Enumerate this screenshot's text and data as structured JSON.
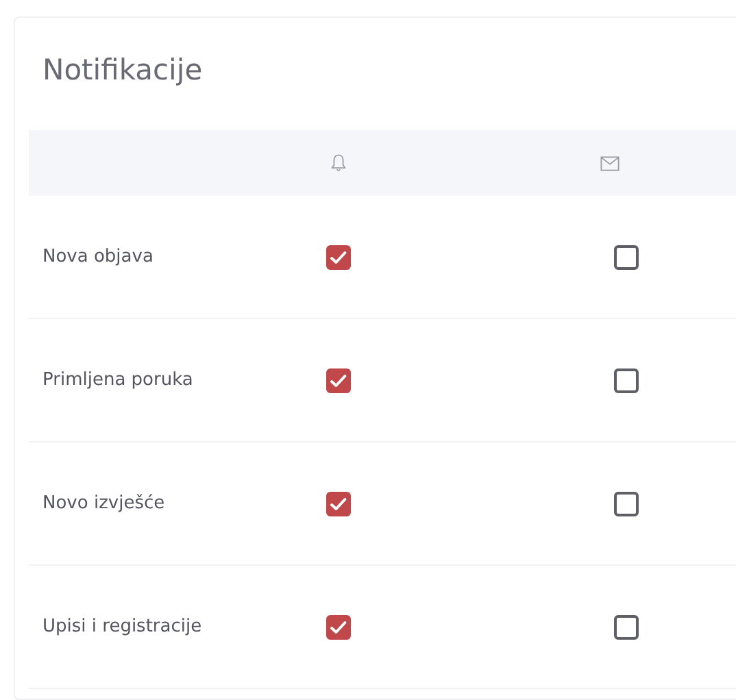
{
  "title": "Notifikacije",
  "rows": [
    {
      "label": "Nova objava",
      "push": {
        "checked": true
      },
      "email": {
        "checked": false
      }
    },
    {
      "label": "Primljena poruka",
      "push": {
        "checked": true
      },
      "email": {
        "checked": false
      }
    },
    {
      "label": "Novo izvješće",
      "push": {
        "checked": true
      },
      "email": {
        "checked": false
      }
    },
    {
      "label": "Upisi i registracije",
      "push": {
        "checked": true
      },
      "email": {
        "checked": false
      }
    }
  ]
}
